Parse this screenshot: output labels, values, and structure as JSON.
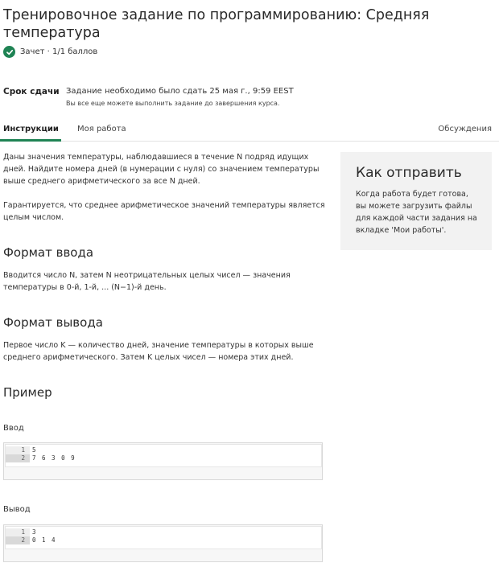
{
  "page": {
    "title": "Тренировочное задание по программированию: Средняя температура",
    "grade": "Зачет · 1/1 баллов"
  },
  "deadline": {
    "label": "Срок сдачи",
    "text": "Задание необходимо было сдать 25 мая г., 9:59 EEST",
    "note": "Вы все еще можете выполнить задание до завершения курса."
  },
  "tabs": {
    "instructions": "Инструкции",
    "my_work": "Моя работа",
    "discussion": "Обсуждения"
  },
  "content": {
    "p1": "Даны значения температуры, наблюдавшиеся в течение N подряд идущих дней. Найдите номера дней (в нумерации с нуля) со значением температуры выше среднего арифметического за все N дней.",
    "p2": "Гарантируется, что среднее арифметическое значений температуры является целым числом.",
    "input_heading": "Формат ввода",
    "input_text": "Вводится число N, затем N неотрицательных целых чисел — значения температуры в 0-й, 1-й, ... (N−1)-й день.",
    "output_heading": "Формат вывода",
    "output_text": "Первое число K — количество дней, значение температуры в которых выше среднего арифметического. Затем K целых чисел — номера этих дней.",
    "example_heading": "Пример",
    "input_label": "Ввод",
    "output_label": "Вывод"
  },
  "example": {
    "input_lines": [
      {
        "n": "1",
        "v": "5"
      },
      {
        "n": "2",
        "v": "7 6 3 0 9"
      }
    ],
    "output_lines": [
      {
        "n": "1",
        "v": "3"
      },
      {
        "n": "2",
        "v": "0 1 4"
      }
    ]
  },
  "sidebar": {
    "title": "Как отправить",
    "text": "Когда работа будет готова, вы можете загрузить файлы для каждой части задания на вкладке 'Мои работы'."
  },
  "colors": {
    "accent": "#1f8354",
    "panel": "#f2f2f2"
  }
}
